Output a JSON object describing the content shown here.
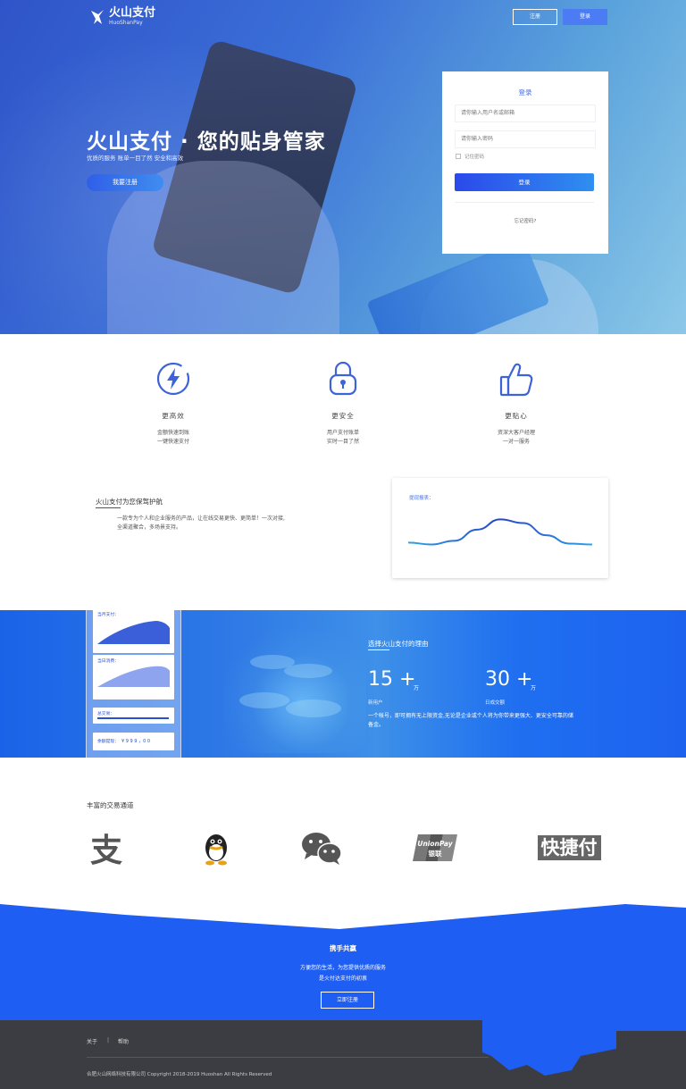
{
  "header": {
    "logo_title": "火山支付",
    "logo_sub": "HuoShanPay",
    "register_label": "注册",
    "login_label": "登录"
  },
  "hero": {
    "title": "火山支付 · 您的贴身管家",
    "subtitle": "优质的服务   账单一目了然   安全和高效",
    "cta_label": "我要注册"
  },
  "login": {
    "heading": "登录",
    "username_placeholder": "请你输入用户名或邮箱",
    "password_placeholder": "请你输入密码",
    "remember_label": "记住密码",
    "submit_label": "登录",
    "forgot_label": "忘记密码?"
  },
  "features": [
    {
      "icon": "lightning-icon",
      "title": "更高效",
      "line1": "金额快速到账",
      "line2": "一键快速支付"
    },
    {
      "icon": "lock-icon",
      "title": "更安全",
      "line1": "用户支付账单",
      "line2": "实时一目了然"
    },
    {
      "icon": "thumbs-up-icon",
      "title": "更贴心",
      "line1": "资深大客户经理",
      "line2": "一对一服务"
    }
  ],
  "intro": {
    "title": "火山支付为您保驾护航",
    "line1": "一款专为个人和企业服务的产品，让在线交易更快、更简单！一次对接,",
    "line2": "全渠道聚合，多场景支持。"
  },
  "chart_card": {
    "label": "提现报表："
  },
  "chart_data": {
    "type": "line",
    "title": "提现报表：",
    "xlabel": "",
    "ylabel": "",
    "x": [
      0,
      1,
      2,
      3,
      4,
      5,
      6,
      7,
      8
    ],
    "series": [
      {
        "values": [
          3,
          2.6,
          3.4,
          5.8,
          8,
          7.2,
          4.6,
          2.8,
          2.6
        ]
      }
    ],
    "ylim": [
      0,
      10
    ],
    "grid": false
  },
  "dashboard": {
    "month_label": "当月支付：",
    "day_label": "当日消费：",
    "total_label": "总交易：",
    "balance_label": "余额提现：",
    "balance_value": "¥ 9 9 9 ，0 0"
  },
  "reasons": {
    "title": "选择火山支付的理由",
    "stat1_number": "15 +",
    "stat1_unit": "万",
    "stat1_label": "新用户",
    "stat2_number": "30 +",
    "stat2_unit": "万",
    "stat2_label": "日成交额",
    "text": "一个帐号，即可拥有无上限资金,无论是企业或个人将为你带来更强大、更安全可靠的储备金。"
  },
  "channels": {
    "title": "丰富的交易通道",
    "items": [
      "支",
      "UnionPay",
      "银联",
      "快捷付"
    ]
  },
  "join": {
    "title": "携手共赢",
    "line1": "方便您的生活，为您提供优质的服务",
    "line2": "是火付达支付的初衷",
    "button_label": "立即注册"
  },
  "footer": {
    "link_about": "关于",
    "separator": "|",
    "link_help": "帮助",
    "copyright": "合肥火山网络科技有限公司 Copyright 2018-2019 Huoshan All Rights Reserved"
  },
  "colors": {
    "brand_blue": "#1f5ef2",
    "footer_bg": "#3b3d42"
  }
}
